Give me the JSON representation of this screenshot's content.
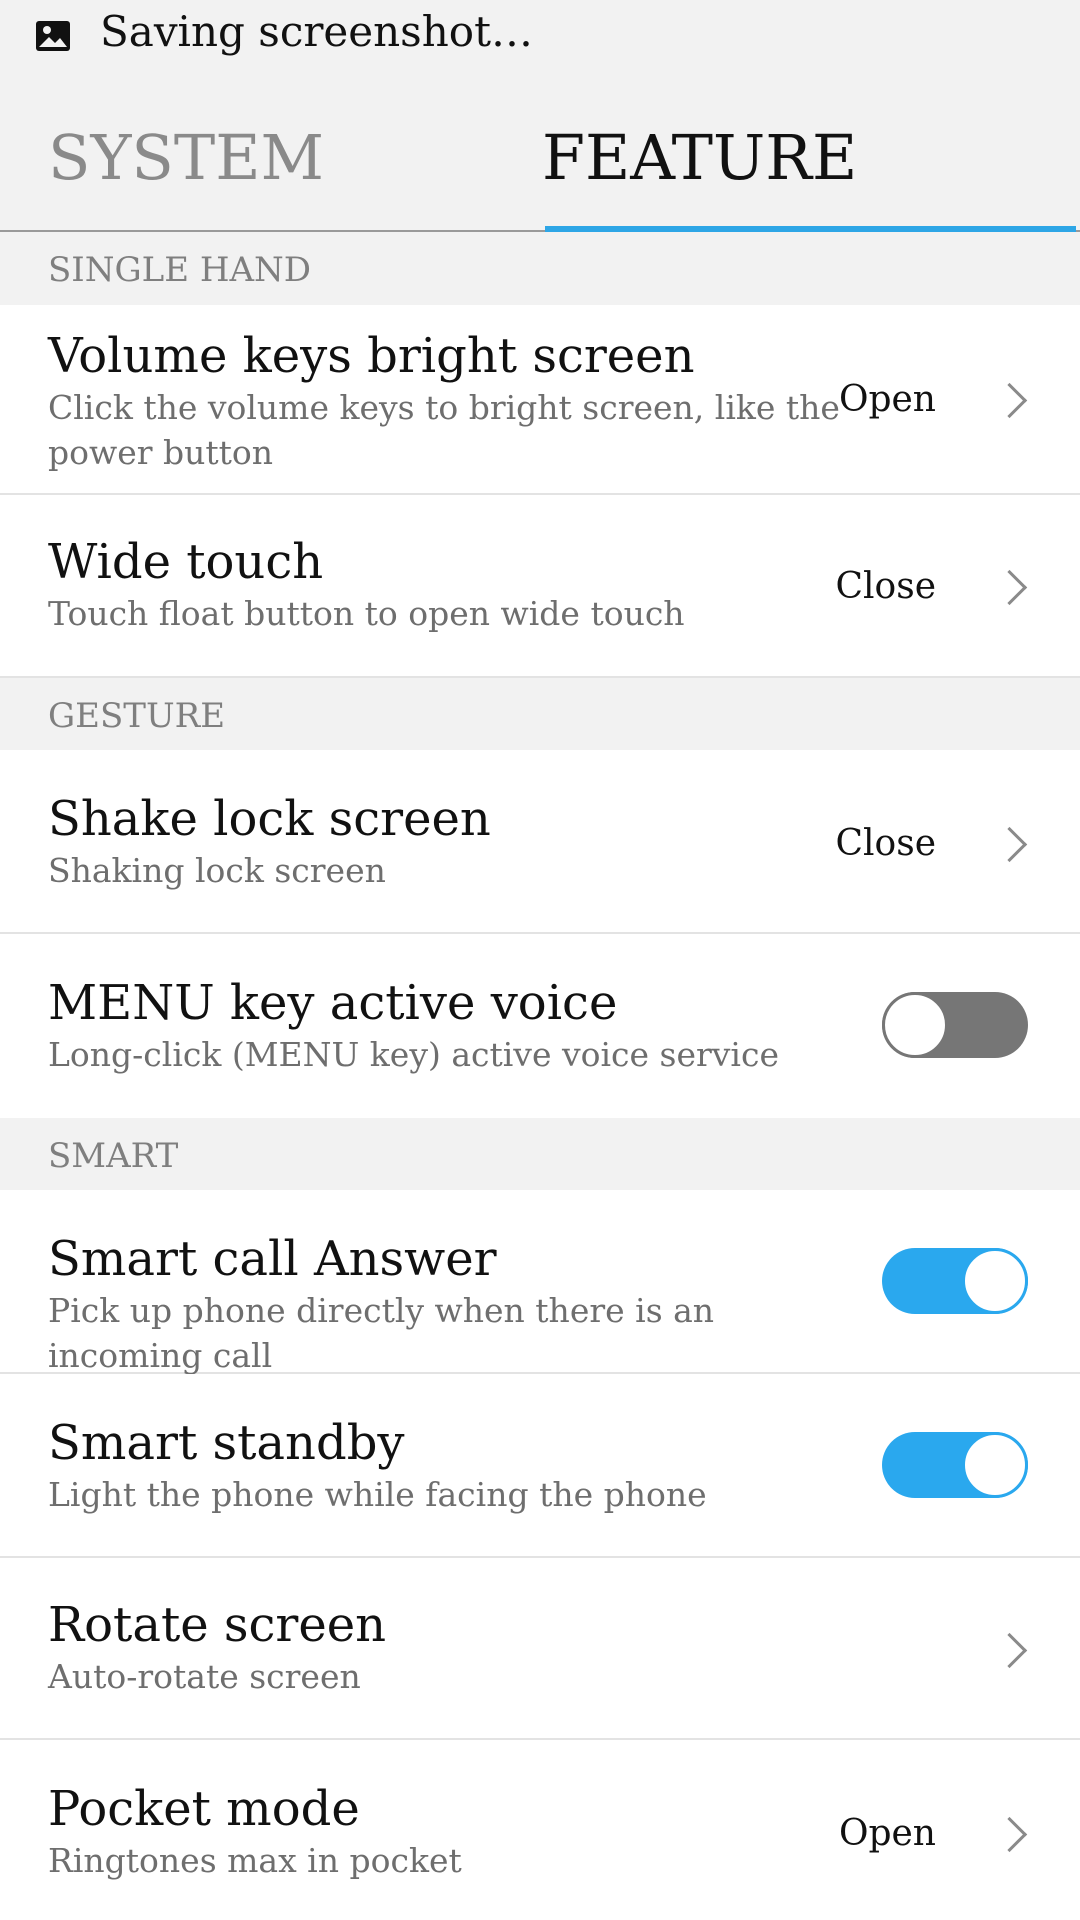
{
  "status_bar": {
    "icon": "image-icon",
    "text": "Saving screenshot…"
  },
  "tabs": [
    {
      "label": "SYSTEM",
      "selected": false
    },
    {
      "label": "FEATURE",
      "selected": true
    }
  ],
  "colors": {
    "accent": "#2ea6e6",
    "toggle_off": "#767676",
    "section_bg": "#f2f2f2"
  },
  "sections": [
    {
      "title": "SINGLE HAND",
      "rows": [
        {
          "title": "Volume keys bright screen",
          "description": "Click  the volume keys to bright screen, like the power button",
          "value": "Open",
          "control": "chevron"
        },
        {
          "title": "Wide touch",
          "description": "Touch float button to open wide touch",
          "value": "Close",
          "control": "chevron"
        }
      ]
    },
    {
      "title": "GESTURE",
      "rows": [
        {
          "title": "Shake lock screen",
          "description": "Shaking lock screen",
          "value": "Close",
          "control": "chevron"
        },
        {
          "title": "MENU key active voice",
          "description": "Long-click (MENU key) active voice service",
          "control": "toggle",
          "toggle_on": false
        }
      ]
    },
    {
      "title": "SMART",
      "rows": [
        {
          "title": "Smart call Answer",
          "description": "Pick up phone directly when there is an incoming call",
          "control": "toggle",
          "toggle_on": true
        },
        {
          "title": "Smart standby",
          "description": "Light the phone while facing the phone",
          "control": "toggle",
          "toggle_on": true
        },
        {
          "title": "Rotate screen",
          "description": "Auto-rotate screen",
          "control": "chevron"
        },
        {
          "title": "Pocket mode",
          "description": "Ringtones max in pocket",
          "value": "Open",
          "control": "chevron"
        }
      ]
    }
  ]
}
